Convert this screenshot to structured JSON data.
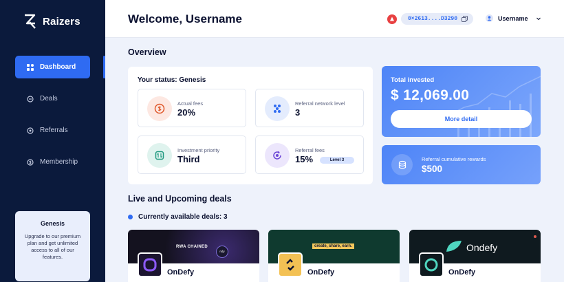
{
  "brand": {
    "name": "Raizers"
  },
  "sidebar": {
    "items": [
      {
        "label": "Dashboard",
        "icon": "grid-icon",
        "active": true
      },
      {
        "label": "Deals",
        "icon": "tag-icon",
        "active": false
      },
      {
        "label": "Referrals",
        "icon": "referral-icon",
        "active": false
      },
      {
        "label": "Membership",
        "icon": "dollar-coin-icon",
        "active": false
      }
    ],
    "promo": {
      "title": "Genesis",
      "text": "Upgrade to our premium plan and get unlimited access to all of our features."
    }
  },
  "header": {
    "welcome": "Welcome, Username",
    "wallet_address": "0×2613....D3290",
    "username": "Username"
  },
  "overview": {
    "title": "Overview",
    "status_title": "Your status: Genesis",
    "stats": [
      {
        "label": "Actual fees",
        "value": "20%",
        "icon": "fee-coin-icon"
      },
      {
        "label": "Referral network level",
        "value": "3",
        "icon": "network-icon"
      },
      {
        "label": "Investment priority",
        "value": "Third",
        "icon": "priority-icon"
      },
      {
        "label": "Referral fees",
        "value": "15%",
        "badge": "Level 3",
        "icon": "refresh-coin-icon"
      }
    ],
    "total_invested": {
      "label": "Total invested",
      "value": "$ 12,069.00",
      "button": "More detail"
    },
    "rewards": {
      "label": "Referral cumulative rewards",
      "value": "$500"
    }
  },
  "deals": {
    "title": "Live  and Upcoming deals",
    "available": "Currently available deals: 3",
    "items": [
      {
        "name": "OnDefy",
        "banner_text": "RWA CHAINED",
        "banner_sub": "ndy"
      },
      {
        "name": "OnDefy",
        "banner_text": "create, share, earn."
      },
      {
        "name": "OnDefy",
        "banner_text": "Ondefy"
      }
    ]
  },
  "colors": {
    "accent": "#2f6bf2",
    "sidebar": "#0b1a3c",
    "background": "#eef2fb"
  }
}
